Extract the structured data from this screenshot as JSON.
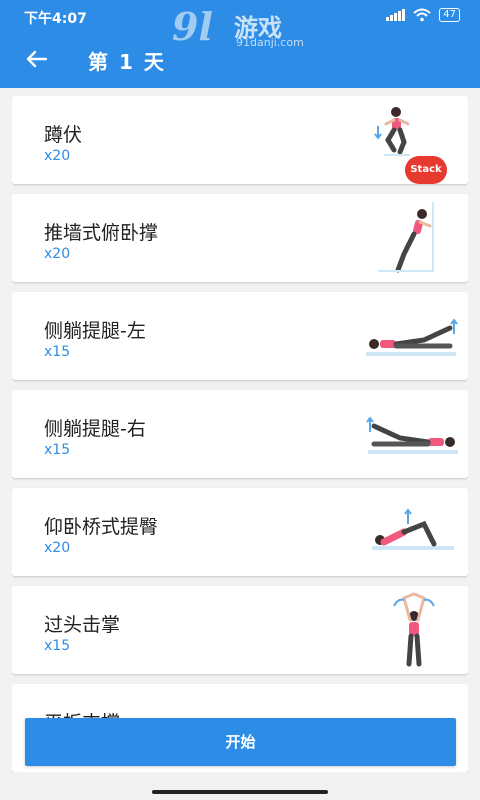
{
  "status": {
    "time": "下午4:07",
    "battery": "47"
  },
  "watermark": {
    "number": "9l",
    "name": "游戏",
    "site": "91danji.com"
  },
  "header": {
    "title": "第 1 天"
  },
  "exercises": [
    {
      "name": "蹲伏",
      "reps": "x20",
      "icon": "squat-illustration"
    },
    {
      "name": "推墙式俯卧撑",
      "reps": "x20",
      "icon": "wall-pushup-illustration"
    },
    {
      "name": "侧躺提腿-左",
      "reps": "x15",
      "icon": "side-leg-raise-left-illustration"
    },
    {
      "name": "侧躺提腿-右",
      "reps": "x15",
      "icon": "side-leg-raise-right-illustration"
    },
    {
      "name": "仰卧桥式提臀",
      "reps": "x20",
      "icon": "glute-bridge-illustration"
    },
    {
      "name": "过头击掌",
      "reps": "x15",
      "icon": "overhead-clap-illustration"
    },
    {
      "name": "平板支撑",
      "reps": "",
      "icon": "plank-illustration"
    }
  ],
  "floating_badge": "Stack",
  "start_button": "开始",
  "colors": {
    "primary": "#2d8ce5",
    "badge": "#e8392e",
    "accent_pink": "#f0587e"
  }
}
